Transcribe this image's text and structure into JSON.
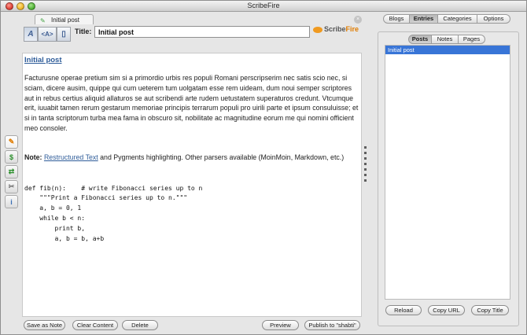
{
  "window": {
    "title": "ScribeFire"
  },
  "left_toolbar": [
    {
      "icon": "notepad-icon",
      "glyph": "✎",
      "color": "#e07c00"
    },
    {
      "icon": "dollar-icon",
      "glyph": "$",
      "color": "#2b8f2b"
    },
    {
      "icon": "sync-icon",
      "glyph": "⇄",
      "color": "#2b8f2b"
    },
    {
      "icon": "tools-icon",
      "glyph": "✂",
      "color": "#6f6f6f"
    },
    {
      "icon": "info-icon",
      "glyph": "i",
      "color": "#3a6fb5"
    }
  ],
  "editor": {
    "tab_label": "Initial post",
    "title_label": "Title:",
    "title_value": "Initial post",
    "brand_prefix": "Scribe",
    "brand_suffix": "Fire",
    "close_icon": "×",
    "format_buttons": [
      {
        "name": "rich-text-mode-button",
        "glyph": "A"
      },
      {
        "name": "html-source-mode-button",
        "glyph": "<A>"
      },
      {
        "name": "notes-mode-button",
        "glyph": "▯"
      }
    ]
  },
  "document": {
    "heading": "Initial post",
    "paragraph": "Facturusne operae pretium sim si a primordio urbis res populi Romani perscripserim nec satis scio nec, si sciam, dicere ausim, quippe qui cum ueterem tum uolgatam esse rem uideam, dum noui semper scriptores aut in rebus certius aliquid allaturos se aut scribendi arte rudem uetustatem superaturos credunt. Vtcumque erit, iuuabit tamen rerum gestarum memoriae principis terrarum populi pro uirili parte et ipsum consuluisse; et si in tanta scriptorum turba mea fama in obscuro sit, nobilitate ac magnitudine eorum me qui nomini officient meo consoler.",
    "note_label": "Note:",
    "note_link": "Restructured Text",
    "note_rest": " and Pygments highlighting. Other parsers available (MoinMoin, Markdown, etc.)",
    "code": "def fib(n):    # write Fibonacci series up to n\n    \"\"\"Print a Fibonacci series up to n.\"\"\"\n    a, b = 0, 1\n    while b < n:\n        print b,\n        a, b = b, a+b"
  },
  "editor_buttons": {
    "save_as_note": "Save as Note",
    "clear_content": "Clear Content",
    "delete": "Delete",
    "preview": "Preview",
    "publish": "Publish to \"shabti\""
  },
  "right_panel": {
    "tabs": [
      "Blogs",
      "Entries",
      "Categories",
      "Options"
    ],
    "selected_tab": "Entries",
    "subtabs": [
      "Posts",
      "Notes",
      "Pages"
    ],
    "selected_subtab": "Posts",
    "entries": [
      "Initial post"
    ],
    "buttons": {
      "reload": "Reload",
      "copy_url": "Copy URL",
      "copy_title": "Copy Title"
    }
  }
}
